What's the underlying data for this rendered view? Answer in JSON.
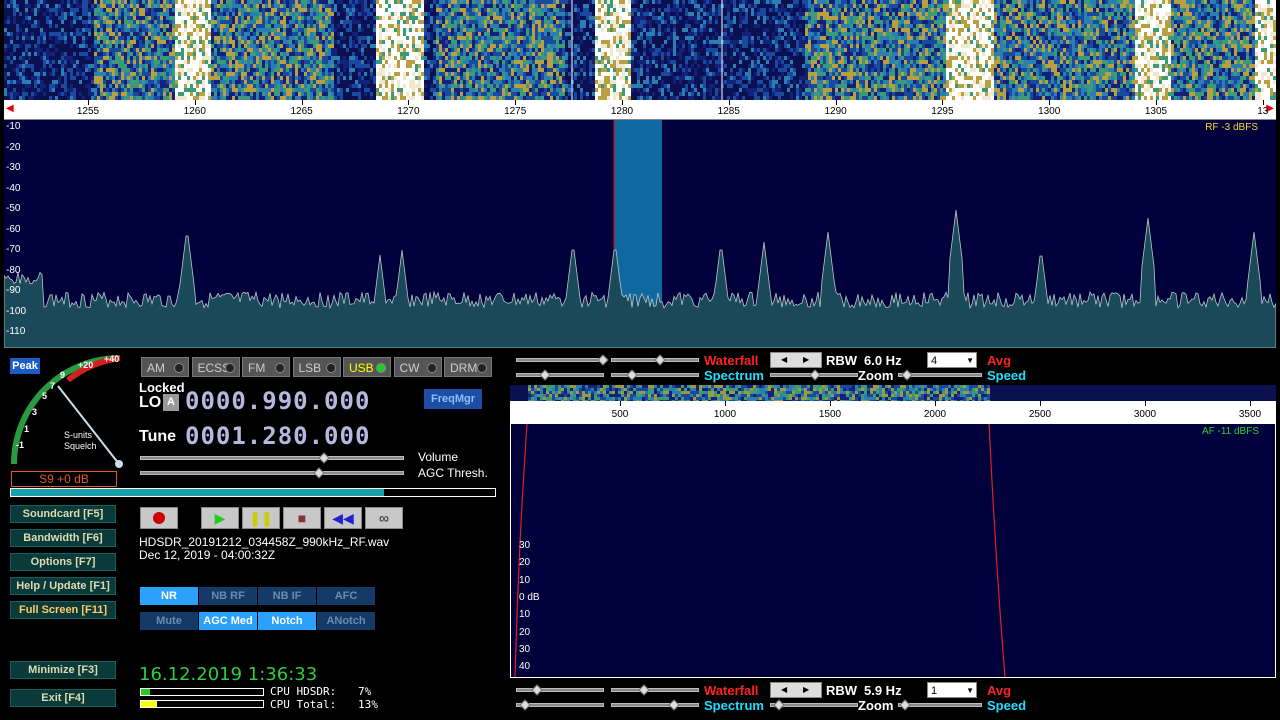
{
  "top_scale": {
    "ticks": [
      "1255",
      "1260",
      "1265",
      "1270",
      "1275",
      "1280",
      "1285",
      "1290",
      "1295",
      "1300",
      "1305",
      "13"
    ],
    "rf_label": "RF  -3 dBFS"
  },
  "db_scale": [
    "-10",
    "-20",
    "-30",
    "-40",
    "-50",
    "-60",
    "-70",
    "-80",
    "-90",
    "-100",
    "-110"
  ],
  "smeter": {
    "peak_label": "Peak",
    "scale": [
      "-1",
      "1",
      "3",
      "5",
      "7",
      "9",
      "+20",
      "+40"
    ],
    "caption1": "S-units",
    "caption2": "Squelch",
    "reading": "S9 +0 dB"
  },
  "modes": [
    {
      "label": "AM",
      "active": false
    },
    {
      "label": "ECSS",
      "active": false
    },
    {
      "label": "FM",
      "active": false
    },
    {
      "label": "LSB",
      "active": false
    },
    {
      "label": "USB",
      "active": true
    },
    {
      "label": "CW",
      "active": false
    },
    {
      "label": "DRM",
      "active": false
    }
  ],
  "freq": {
    "locked_label": "Locked",
    "lo_label": "LO",
    "lo_btn": "A",
    "lo_value": "0000.990.000",
    "tune_label": "Tune",
    "tune_value": "0001.280.000",
    "freqmgr": "FreqMgr",
    "volume_label": "Volume",
    "volume_level": 0.7,
    "agc_label": "AGC Thresh.",
    "agc_level": 0.68
  },
  "side_buttons": [
    {
      "label": "Soundcard  [F5]",
      "name": "soundcard-button"
    },
    {
      "label": "Bandwidth  [F6]",
      "name": "bandwidth-button"
    },
    {
      "label": "Options  [F7]",
      "name": "options-button"
    },
    {
      "label": "Help / Update  [F1]",
      "name": "help-button"
    },
    {
      "label": "Full Screen  [F11]",
      "name": "fullscreen-button"
    },
    {
      "label": "Minimize  [F3]",
      "name": "minimize-button"
    },
    {
      "label": "Exit  [F4]",
      "name": "exit-button"
    }
  ],
  "recording": {
    "filename": "HDSDR_20191212_034458Z_990kHz_RF.wav",
    "date": "Dec 12, 2019 - 04:00:32Z"
  },
  "dsp_row1": [
    {
      "label": "NR",
      "on": true
    },
    {
      "label": "NB RF",
      "on": false
    },
    {
      "label": "NB IF",
      "on": false
    },
    {
      "label": "AFC",
      "on": false
    }
  ],
  "dsp_row2": [
    {
      "label": "Mute",
      "on": false
    },
    {
      "label": "AGC Med",
      "on": true
    },
    {
      "label": "Notch",
      "on": true
    },
    {
      "label": "ANotch",
      "on": false
    }
  ],
  "status": {
    "clock": "16.12.2019 1:36:33",
    "cpu_hdsdr_label": "CPU HDSDR:",
    "cpu_hdsdr": "7%",
    "cpu_total_label": "CPU Total:",
    "cpu_total": "13%"
  },
  "rf_controls": {
    "waterfall_label": "Waterfall",
    "spectrum_label": "Spectrum",
    "rbw_label": "RBW",
    "rbw_value": "6.0 Hz",
    "zoom_label": "Zoom",
    "avg_label": "Avg",
    "avg_value": "4",
    "speed_label": "Speed"
  },
  "af_controls": {
    "waterfall_label": "Waterfall",
    "spectrum_label": "Spectrum",
    "rbw_label": "RBW",
    "rbw_value": "5.9 Hz",
    "zoom_label": "Zoom",
    "avg_label": "Avg",
    "avg_value": "1",
    "speed_label": "Speed"
  },
  "af_scale": {
    "ticks": [
      "500",
      "1000",
      "1500",
      "2000",
      "2500",
      "3000",
      "3500"
    ],
    "af_label": "AF -11 dBFS",
    "db": [
      "30",
      "20",
      "10",
      "0 dB",
      "10",
      "20",
      "30",
      "40"
    ]
  },
  "colors": {
    "accent": "#2aa0ff",
    "clock": "#2ecc40",
    "red": "#ff2020",
    "cyan": "#22ddff"
  }
}
